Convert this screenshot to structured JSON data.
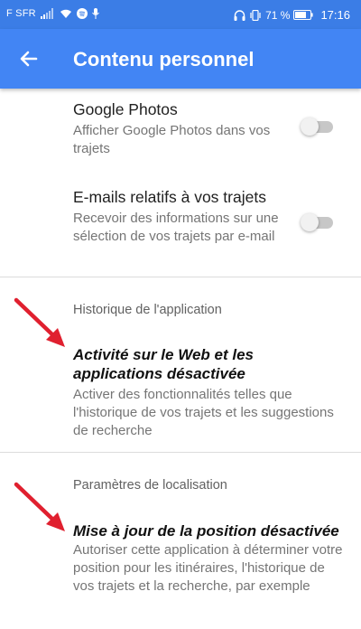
{
  "statusbar": {
    "carrier": "F SFR",
    "battery": "71 %",
    "time": "17:16",
    "icons": [
      "signal-icon",
      "wifi-icon",
      "spotify-icon",
      "mic-icon",
      "headphones-icon",
      "vibrate-icon",
      "battery-icon"
    ]
  },
  "appbar": {
    "title": "Contenu personnel",
    "back_icon": "arrow-back-icon"
  },
  "items": {
    "photos": {
      "title": "Google Photos",
      "subtitle": "Afficher Google Photos dans vos trajets",
      "toggle": "off"
    },
    "emails": {
      "title": "E-mails relatifs à vos trajets",
      "subtitle": "Recevoir des informations sur une sélection de vos trajets par e-mail",
      "toggle": "off"
    }
  },
  "history": {
    "header": "Historique de l'application",
    "title": "Activité sur le Web et les applications désactivée",
    "subtitle": "Activer des fonctionnalités telles que l'historique de vos trajets et les suggestions de recherche"
  },
  "location": {
    "header": "Paramètres de localisation",
    "title": "Mise à jour de la position désactivée",
    "subtitle": "Autoriser cette application à déterminer votre position pour les itinéraires, l'historique de vos trajets et la recherche, par exemple"
  },
  "colors": {
    "statusbar": "#3b7de6",
    "appbar": "#4285f4",
    "annotation_arrow": "#e0202f"
  }
}
